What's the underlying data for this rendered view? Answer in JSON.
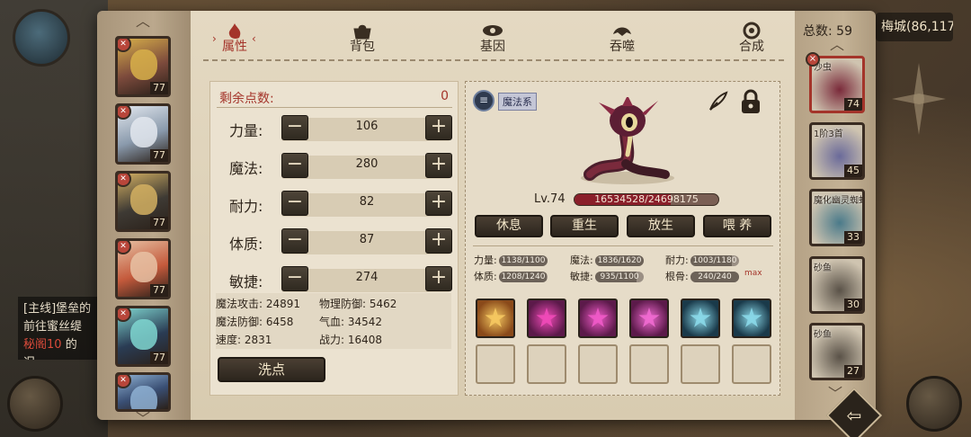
{
  "map": {
    "city_label": "梅城(86,117)",
    "quest_lines": [
      "[主线]堡垒的",
      "前往蜜丝缇",
      "的",
      "况"
    ],
    "quest_highlight": "秘阁10"
  },
  "tabs": [
    {
      "label": "属性",
      "icon": "flame-icon",
      "active": true
    },
    {
      "label": "背包",
      "icon": "bag-icon",
      "active": false
    },
    {
      "label": "基因",
      "icon": "eye-icon",
      "active": false
    },
    {
      "label": "吞噬",
      "icon": "maw-icon",
      "active": false
    },
    {
      "label": "合成",
      "icon": "swirl-icon",
      "active": false
    }
  ],
  "heroes": [
    {
      "level": "77",
      "color": "#7c4a3c",
      "accent": "#d8b04a"
    },
    {
      "level": "77",
      "color": "#8a9aac",
      "accent": "#e3e8ef"
    },
    {
      "level": "77",
      "color": "#3e3a34",
      "accent": "#d4b062"
    },
    {
      "level": "77",
      "color": "#c45a3c",
      "accent": "#e7c2a4"
    },
    {
      "level": "77",
      "color": "#2a3c54",
      "accent": "#7fd6d0"
    },
    {
      "level": "",
      "color": "#3a4f74",
      "accent": "#8fb2d4"
    }
  ],
  "stats": {
    "points_label": "剩余点数:",
    "points_value": "0",
    "rows": [
      {
        "label": "力量:",
        "value": "106"
      },
      {
        "label": "魔法:",
        "value": "280"
      },
      {
        "label": "耐力:",
        "value": "82"
      },
      {
        "label": "体质:",
        "value": "87"
      },
      {
        "label": "敏捷:",
        "value": "274"
      }
    ],
    "minus": "−",
    "plus": "+",
    "derived": [
      {
        "label": "魔法攻击:",
        "value": "24891"
      },
      {
        "label": "物理防御:",
        "value": "5462"
      },
      {
        "label": "魔法防御:",
        "value": "6458"
      },
      {
        "label": "气血:",
        "value": "34542"
      },
      {
        "label": "速度:",
        "value": "2831"
      },
      {
        "label": "战力:",
        "value": "16408"
      }
    ],
    "wash_label": "洗点"
  },
  "pet": {
    "school": "魔法系",
    "list_icon": "≡",
    "level_label": "Lv.74",
    "hp_text": "16534528/24698175",
    "hp_fraction": 0.669,
    "actions": [
      "休息",
      "重生",
      "放生",
      "喂 养"
    ],
    "attributes": [
      {
        "label": "力量:",
        "value": "1138/1100",
        "fraction": 1.0
      },
      {
        "label": "魔法:",
        "value": "1836/1620",
        "fraction": 1.0
      },
      {
        "label": "耐力:",
        "value": "1003/1180",
        "fraction": 0.85
      },
      {
        "label": "体质:",
        "value": "1208/1240",
        "fraction": 0.974
      },
      {
        "label": "敏捷:",
        "value": "935/1100",
        "fraction": 0.85
      },
      {
        "label": "根骨:",
        "value": "240/240",
        "fraction": 1.0
      }
    ],
    "max_tag": "max",
    "skills": [
      {
        "icon": "vortex-skill-icon",
        "bg": "#8a4a1a",
        "fg": "#f5c860"
      },
      {
        "icon": "slash-skill-icon",
        "bg": "#5c1a4a",
        "fg": "#f04ab8"
      },
      {
        "icon": "burst-skill-icon",
        "bg": "#5c1a4a",
        "fg": "#f05ac8"
      },
      {
        "icon": "star-skill-icon",
        "bg": "#5c1a4a",
        "fg": "#f06ad0"
      },
      {
        "icon": "spirit-skill-icon",
        "bg": "#1a3a4a",
        "fg": "#8ad8e8"
      },
      {
        "icon": "claw-skill-icon",
        "bg": "#1a3a4a",
        "fg": "#8ad8e8"
      }
    ]
  },
  "pet_list": {
    "total": "总数: 59",
    "items": [
      {
        "name": "沙虫",
        "level": "74",
        "selected": true,
        "color": "#7a2a3a"
      },
      {
        "name": "1阶3首",
        "level": "45",
        "selected": false,
        "color": "#6a6a9a"
      },
      {
        "name": "魔化幽灵蜘蛛",
        "level": "33",
        "selected": false,
        "color": "#4a7a8a"
      },
      {
        "name": "砂鱼",
        "level": "30",
        "selected": false,
        "color": "#5a5248"
      },
      {
        "name": "砂鱼",
        "level": "27",
        "selected": false,
        "color": "#5a5248"
      }
    ]
  }
}
